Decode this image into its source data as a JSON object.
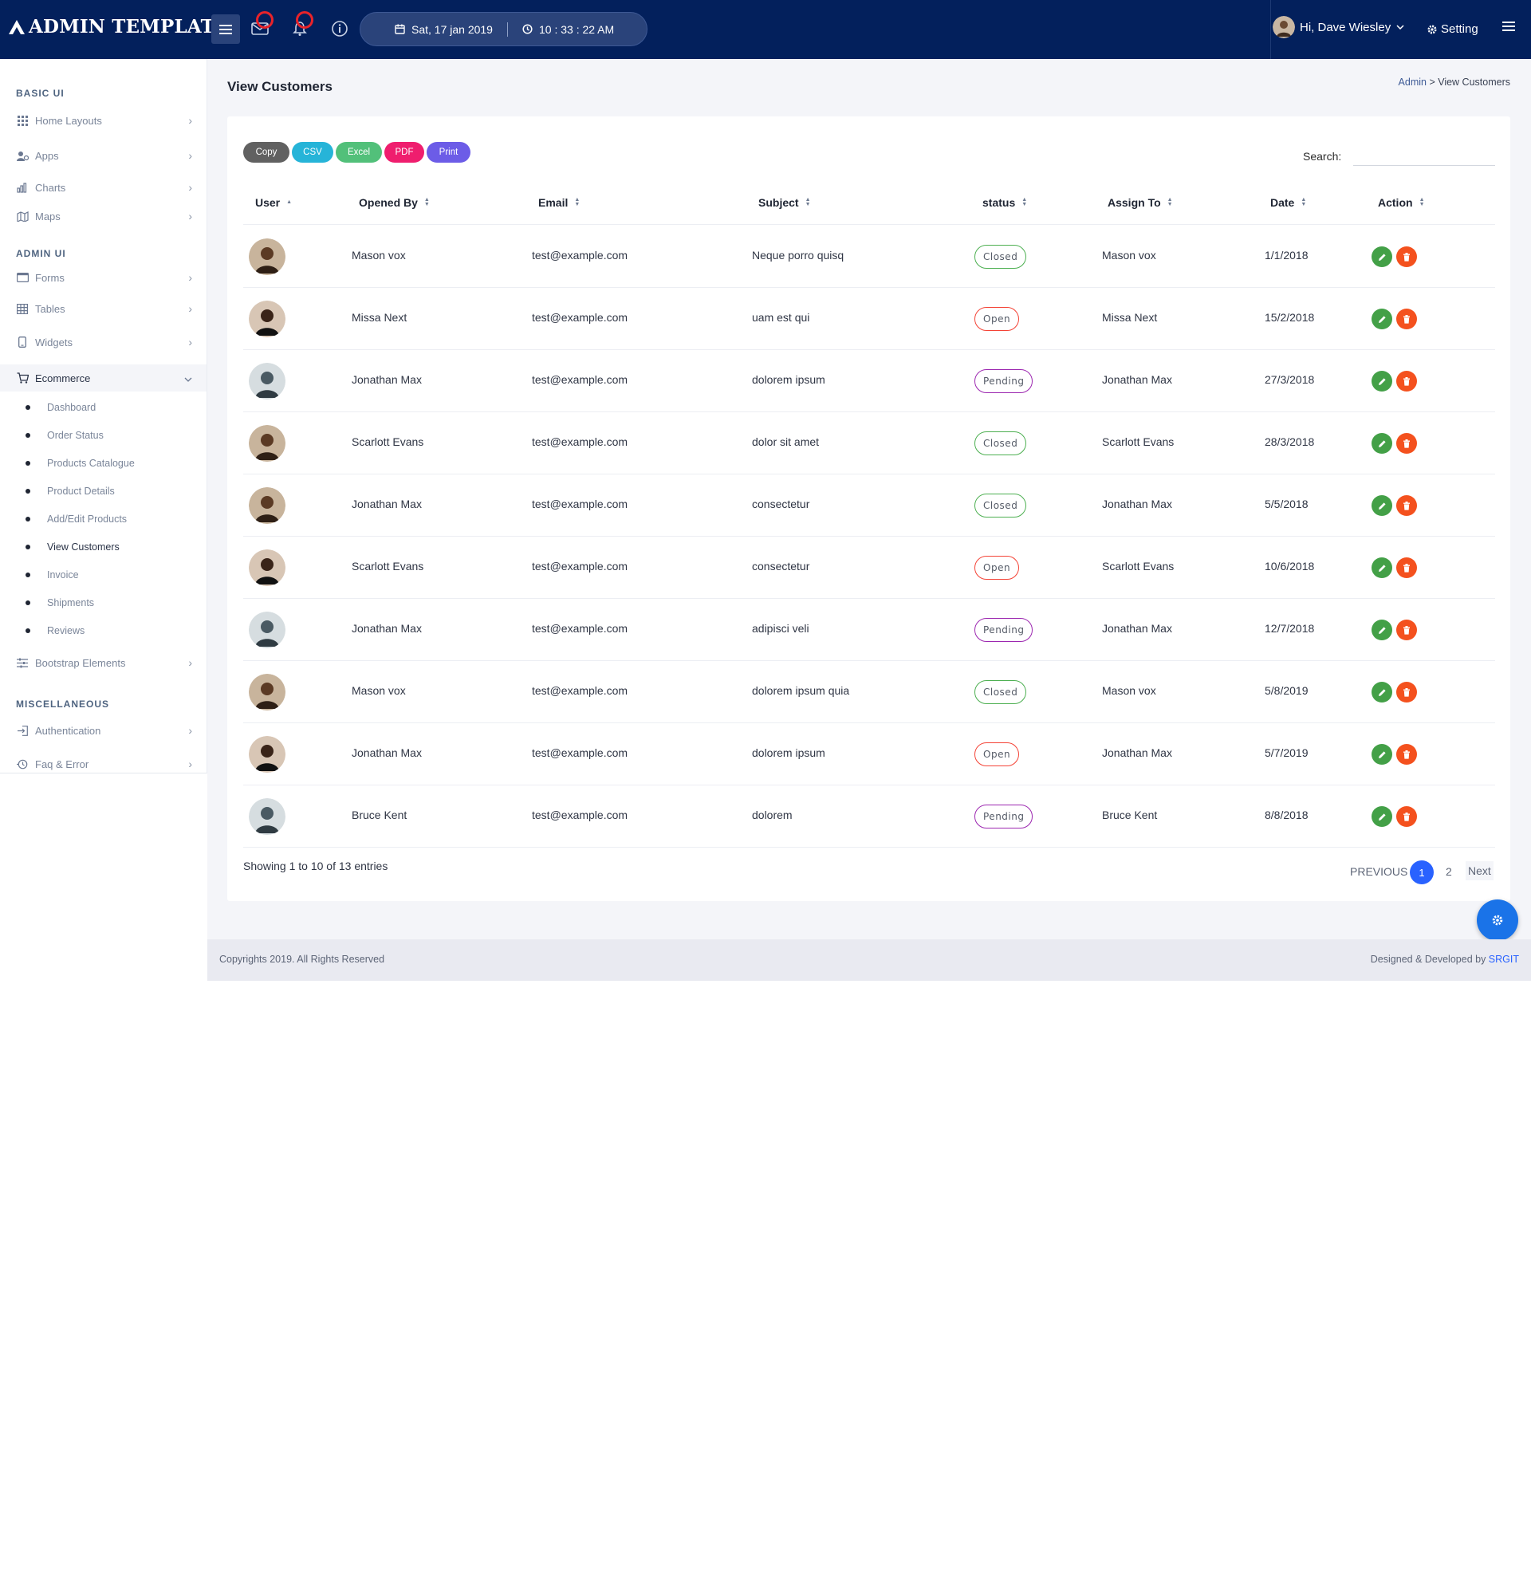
{
  "app": {
    "brand": "ADMIN TEMPLATE",
    "date": "Sat, 17 jan 2019",
    "time": "10 : 33 : 22 AM",
    "user_greeting": "Hi, Dave Wiesley",
    "setting_label": "Setting"
  },
  "sidebar": {
    "section_basic": "BASIC UI",
    "section_admin": "ADMIN UI",
    "section_misc": "MISCELLANEOUS",
    "items": [
      {
        "label": "Home Layouts",
        "icon": "grid-icon"
      },
      {
        "label": "Apps",
        "icon": "users-icon"
      },
      {
        "label": "Charts",
        "icon": "bar-chart-icon"
      },
      {
        "label": "Maps",
        "icon": "map-icon"
      },
      {
        "label": "Forms",
        "icon": "form-icon"
      },
      {
        "label": "Tables",
        "icon": "table-icon"
      },
      {
        "label": "Widgets",
        "icon": "mobile-icon"
      },
      {
        "label": "Ecommerce",
        "icon": "cart-icon"
      },
      {
        "label": "Bootstrap Elements",
        "icon": "sliders-icon"
      },
      {
        "label": "Authentication",
        "icon": "login-icon"
      },
      {
        "label": "Faq & Error",
        "icon": "history-icon"
      }
    ],
    "ecommerce_sub": [
      "Dashboard",
      "Order Status",
      "Products Catalogue",
      "Product Details",
      "Add/Edit Products",
      "View Customers",
      "Invoice",
      "Shipments",
      "Reviews"
    ]
  },
  "page": {
    "title": "View Customers",
    "breadcrumb_root": "Admin",
    "breadcrumb_sep": " > ",
    "breadcrumb_current": "View Customers"
  },
  "export_buttons": [
    {
      "label": "Copy",
      "color": "#616161"
    },
    {
      "label": "CSV",
      "color": "#26b4d8"
    },
    {
      "label": "Excel",
      "color": "#52c07a"
    },
    {
      "label": "PDF",
      "color": "#ef1e6e"
    },
    {
      "label": "Print",
      "color": "#6c5ce7"
    }
  ],
  "search": {
    "label": "Search:",
    "value": ""
  },
  "table": {
    "columns": [
      "User",
      "Opened By",
      "Email",
      "Subject",
      "status",
      "Assign To",
      "Date",
      "Action"
    ],
    "rows": [
      {
        "opened_by": "Mason vox",
        "email": "test@example.com",
        "subject": "Neque porro quisq",
        "status": "Closed",
        "assign_to": "Mason vox",
        "date": "1/1/2018"
      },
      {
        "opened_by": "Missa Next",
        "email": "test@example.com",
        "subject": "uam est qui",
        "status": "Open",
        "assign_to": "Missa Next",
        "date": "15/2/2018"
      },
      {
        "opened_by": "Jonathan Max",
        "email": "test@example.com",
        "subject": "dolorem ipsum",
        "status": "Pending",
        "assign_to": "Jonathan Max",
        "date": "27/3/2018"
      },
      {
        "opened_by": "Scarlott Evans",
        "email": "test@example.com",
        "subject": "dolor sit amet",
        "status": "Closed",
        "assign_to": "Scarlott Evans",
        "date": "28/3/2018"
      },
      {
        "opened_by": "Jonathan Max",
        "email": "test@example.com",
        "subject": "consectetur",
        "status": "Closed",
        "assign_to": "Jonathan Max",
        "date": "5/5/2018"
      },
      {
        "opened_by": "Scarlott Evans",
        "email": "test@example.com",
        "subject": "consectetur",
        "status": "Open",
        "assign_to": "Scarlott Evans",
        "date": "10/6/2018"
      },
      {
        "opened_by": "Jonathan Max",
        "email": "test@example.com",
        "subject": "adipisci veli",
        "status": "Pending",
        "assign_to": "Jonathan Max",
        "date": "12/7/2018"
      },
      {
        "opened_by": "Mason vox",
        "email": "test@example.com",
        "subject": "dolorem ipsum quia",
        "status": "Closed",
        "assign_to": "Mason vox",
        "date": "5/8/2019"
      },
      {
        "opened_by": "Jonathan Max",
        "email": "test@example.com",
        "subject": "dolorem ipsum",
        "status": "Open",
        "assign_to": "Jonathan Max",
        "date": "5/7/2019"
      },
      {
        "opened_by": "Bruce Kent",
        "email": "test@example.com",
        "subject": "dolorem",
        "status": "Pending",
        "assign_to": "Bruce Kent",
        "date": "8/8/2018"
      }
    ]
  },
  "pagination": {
    "info": "Showing 1 to 10 of 13 entries",
    "previous": "PREVIOUS",
    "pages": [
      "1",
      "2"
    ],
    "next": "Next"
  },
  "footer": {
    "copyright": "Copyrights 2019. All Rights Reserved",
    "designed_by": "Designed & Developed by ",
    "designer": "SRGIT"
  },
  "colors": {
    "topbar": "#03205c",
    "accent": "#2962ff",
    "closed": "#4caf50",
    "open": "#f44336",
    "pending": "#9c27b0"
  }
}
